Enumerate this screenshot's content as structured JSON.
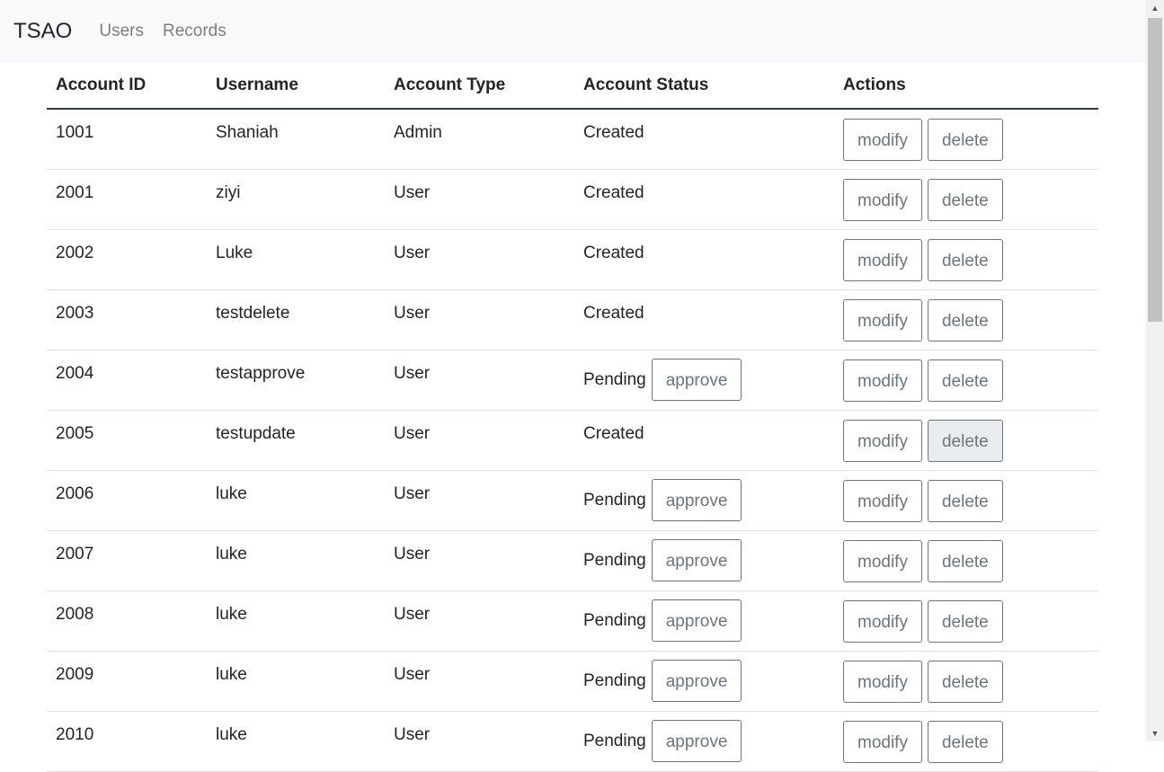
{
  "navbar": {
    "brand": "TSAO",
    "links": [
      "Users",
      "Records"
    ]
  },
  "table": {
    "headers": [
      "Account ID",
      "Username",
      "Account Type",
      "Account Status",
      "Actions"
    ],
    "rows": [
      {
        "id": "1001",
        "username": "Shaniah",
        "type": "Admin",
        "status": "Created",
        "approve": false,
        "delete_active": false
      },
      {
        "id": "2001",
        "username": "ziyi",
        "type": "User",
        "status": "Created",
        "approve": false,
        "delete_active": false
      },
      {
        "id": "2002",
        "username": "Luke",
        "type": "User",
        "status": "Created",
        "approve": false,
        "delete_active": false
      },
      {
        "id": "2003",
        "username": "testdelete",
        "type": "User",
        "status": "Created",
        "approve": false,
        "delete_active": false
      },
      {
        "id": "2004",
        "username": "testapprove",
        "type": "User",
        "status": "Pending",
        "approve": true,
        "delete_active": false
      },
      {
        "id": "2005",
        "username": "testupdate",
        "type": "User",
        "status": "Created",
        "approve": false,
        "delete_active": true
      },
      {
        "id": "2006",
        "username": "luke",
        "type": "User",
        "status": "Pending",
        "approve": true,
        "delete_active": false
      },
      {
        "id": "2007",
        "username": "luke",
        "type": "User",
        "status": "Pending",
        "approve": true,
        "delete_active": false
      },
      {
        "id": "2008",
        "username": "luke",
        "type": "User",
        "status": "Pending",
        "approve": true,
        "delete_active": false
      },
      {
        "id": "2009",
        "username": "luke",
        "type": "User",
        "status": "Pending",
        "approve": true,
        "delete_active": false
      },
      {
        "id": "2010",
        "username": "luke",
        "type": "User",
        "status": "Pending",
        "approve": true,
        "delete_active": false
      }
    ],
    "labels": {
      "modify": "modify",
      "delete": "delete",
      "approve": "approve"
    }
  },
  "scrollbar": {
    "up_icon": "▲",
    "down_icon": "▼"
  }
}
